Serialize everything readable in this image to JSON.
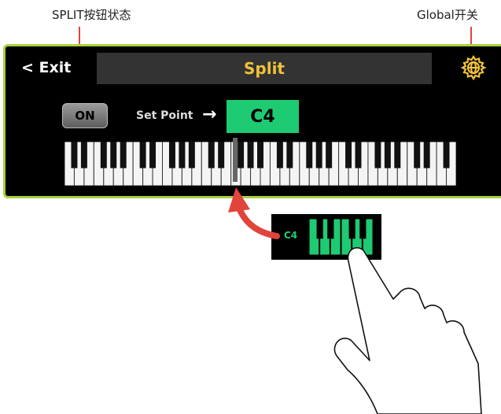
{
  "callouts": {
    "split_toggle": "SPLIT按钮状态",
    "global_switch": "Global开关"
  },
  "header": {
    "exit_label": "< Exit",
    "title": "Split"
  },
  "controls": {
    "on_button_label": "ON",
    "set_point_label": "Set Point",
    "set_point_arrow": "→",
    "set_point_value": "C4"
  },
  "zoom": {
    "note_label": "C4"
  },
  "icons": {
    "global": "global-gear-icon",
    "arrow": "right-arrow-icon",
    "pointer": "pointing-hand-icon",
    "curved_arrow": "curved-arrow-icon"
  },
  "colors": {
    "panel_border": "#a8d13c",
    "title_text": "#f0c23a",
    "set_point_bg": "#1ecb73",
    "callout_line": "#e0443b",
    "lower_keys": "#1ecb73"
  }
}
